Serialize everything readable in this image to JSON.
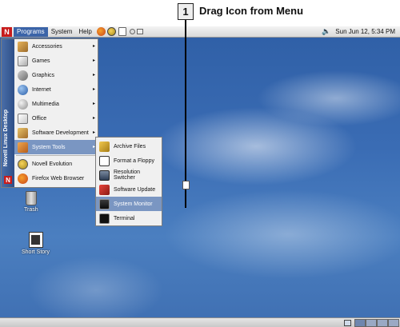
{
  "callout": {
    "number": "1",
    "text": "Drag Icon from Menu"
  },
  "top_panel": {
    "logo": "N",
    "menus": [
      "Programs",
      "System",
      "Help"
    ],
    "clock": "Sun Jun 12,  5:34 PM",
    "icons": [
      "novell-logo-icon",
      "firefox-icon",
      "evolution-icon",
      "document-icon",
      "speaker-icon"
    ]
  },
  "programs_menu": {
    "sidebar_text": "Novell Linux Desktop",
    "sidebar_logo": "N",
    "items": [
      {
        "label": "Accessories",
        "submenu": true,
        "selected": false
      },
      {
        "label": "Games",
        "submenu": true,
        "selected": false
      },
      {
        "label": "Graphics",
        "submenu": true,
        "selected": false
      },
      {
        "label": "Internet",
        "submenu": true,
        "selected": false
      },
      {
        "label": "Multimedia",
        "submenu": true,
        "selected": false
      },
      {
        "label": "Office",
        "submenu": true,
        "selected": false
      },
      {
        "label": "Software Development",
        "submenu": true,
        "selected": false
      },
      {
        "label": "System Tools",
        "submenu": true,
        "selected": true
      },
      {
        "label": "Novell Evolution",
        "submenu": false,
        "selected": false
      },
      {
        "label": "Firefox Web Browser",
        "submenu": false,
        "selected": false
      }
    ],
    "arrow": "▸"
  },
  "system_tools_submenu": {
    "items": [
      {
        "label": "Archive Files",
        "selected": false
      },
      {
        "label": "Format a Floppy",
        "selected": false
      },
      {
        "label": "Resolution Switcher",
        "selected": false
      },
      {
        "label": "Software Update",
        "selected": false
      },
      {
        "label": "System Monitor",
        "selected": true
      },
      {
        "label": "Terminal",
        "selected": false
      }
    ]
  },
  "desktop_icons": [
    {
      "label": "Trash"
    },
    {
      "label": "Short Story"
    }
  ],
  "colors": {
    "menu_selected": "#7a96c2",
    "programs_button": "#3b64a8",
    "novell_red": "#c81c1c",
    "desktop_sky": "#3a6cb4"
  }
}
